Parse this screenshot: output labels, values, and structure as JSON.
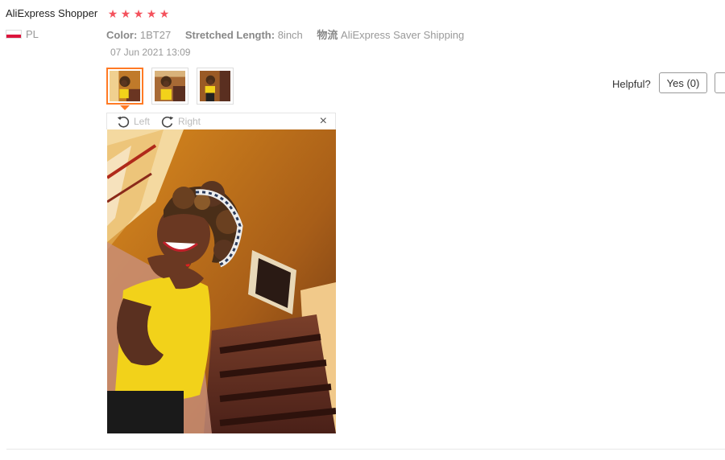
{
  "review": {
    "user_name": "AliExpress Shopper",
    "rating": 5,
    "country_code": "PL",
    "attributes": [
      {
        "key": "Color:",
        "value": "1BT27"
      },
      {
        "key": "Stretched Length:",
        "value": "8inch"
      },
      {
        "key": "物流",
        "value": "AliExpress Saver Shipping"
      }
    ],
    "date": "07 Jun 2021 13:09",
    "thumbnails": 3,
    "selected_thumbnail": 1
  },
  "viewer": {
    "rotate_left_label": "Left",
    "rotate_right_label": "Right",
    "close_glyph": "×"
  },
  "helpful": {
    "label": "Helpful?",
    "yes_label": "Yes (0)"
  },
  "colors": {
    "star": "#f4525d",
    "selection": "#ff7a24",
    "flag_red": "#dc143c",
    "muted_text": "#999999"
  },
  "icons": [
    "star-icon",
    "poland-flag-icon",
    "rotate-left-icon",
    "rotate-right-icon",
    "close-icon"
  ]
}
